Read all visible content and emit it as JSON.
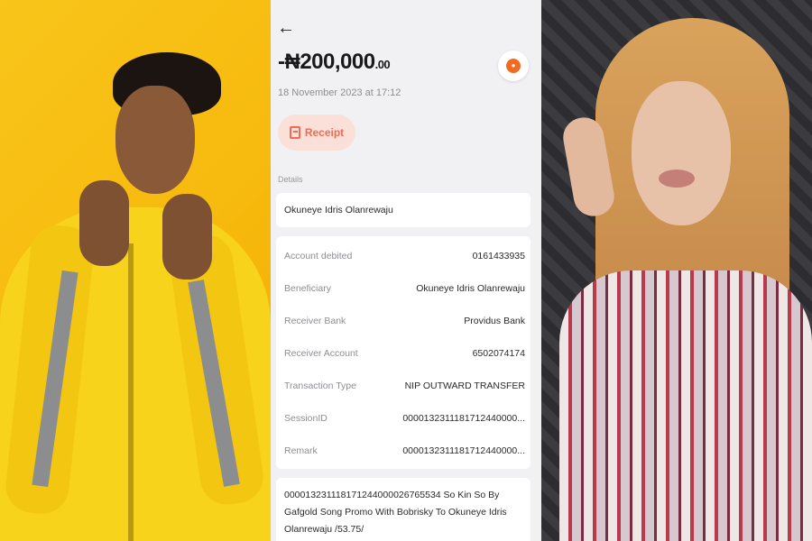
{
  "receipt": {
    "amount_prefix": "-₦",
    "amount_main": "200,000",
    "amount_decimal": ".00",
    "date": "18 November 2023 at 17:12",
    "receipt_button": "Receipt",
    "details_label": "Details",
    "beneficiary_name": "Okuneye Idris Olanrewaju",
    "rows": [
      {
        "key": "Account debited",
        "value": "0161433935"
      },
      {
        "key": "Beneficiary",
        "value": "Okuneye Idris Olanrewaju"
      },
      {
        "key": "Receiver Bank",
        "value": "Providus Bank"
      },
      {
        "key": "Receiver Account",
        "value": "6502074174"
      },
      {
        "key": "Transaction Type",
        "value": "NIP OUTWARD TRANSFER"
      },
      {
        "key": "SessionID",
        "value": "0000132311181712440000..."
      },
      {
        "key": "Remark",
        "value": "0000132311181712440000..."
      }
    ],
    "remark_full": "000013231118171244000026765534 So Kin So By Gafgold Song Promo With Bobrisky To Okuneye Idris Olanrewaju /53.75/"
  },
  "icons": {
    "back": "arrow-left-icon",
    "avatar": "bank-logo-icon",
    "receipt": "receipt-icon"
  },
  "colors": {
    "accent": "#f26a4f",
    "left_background": "#f9c51a"
  }
}
